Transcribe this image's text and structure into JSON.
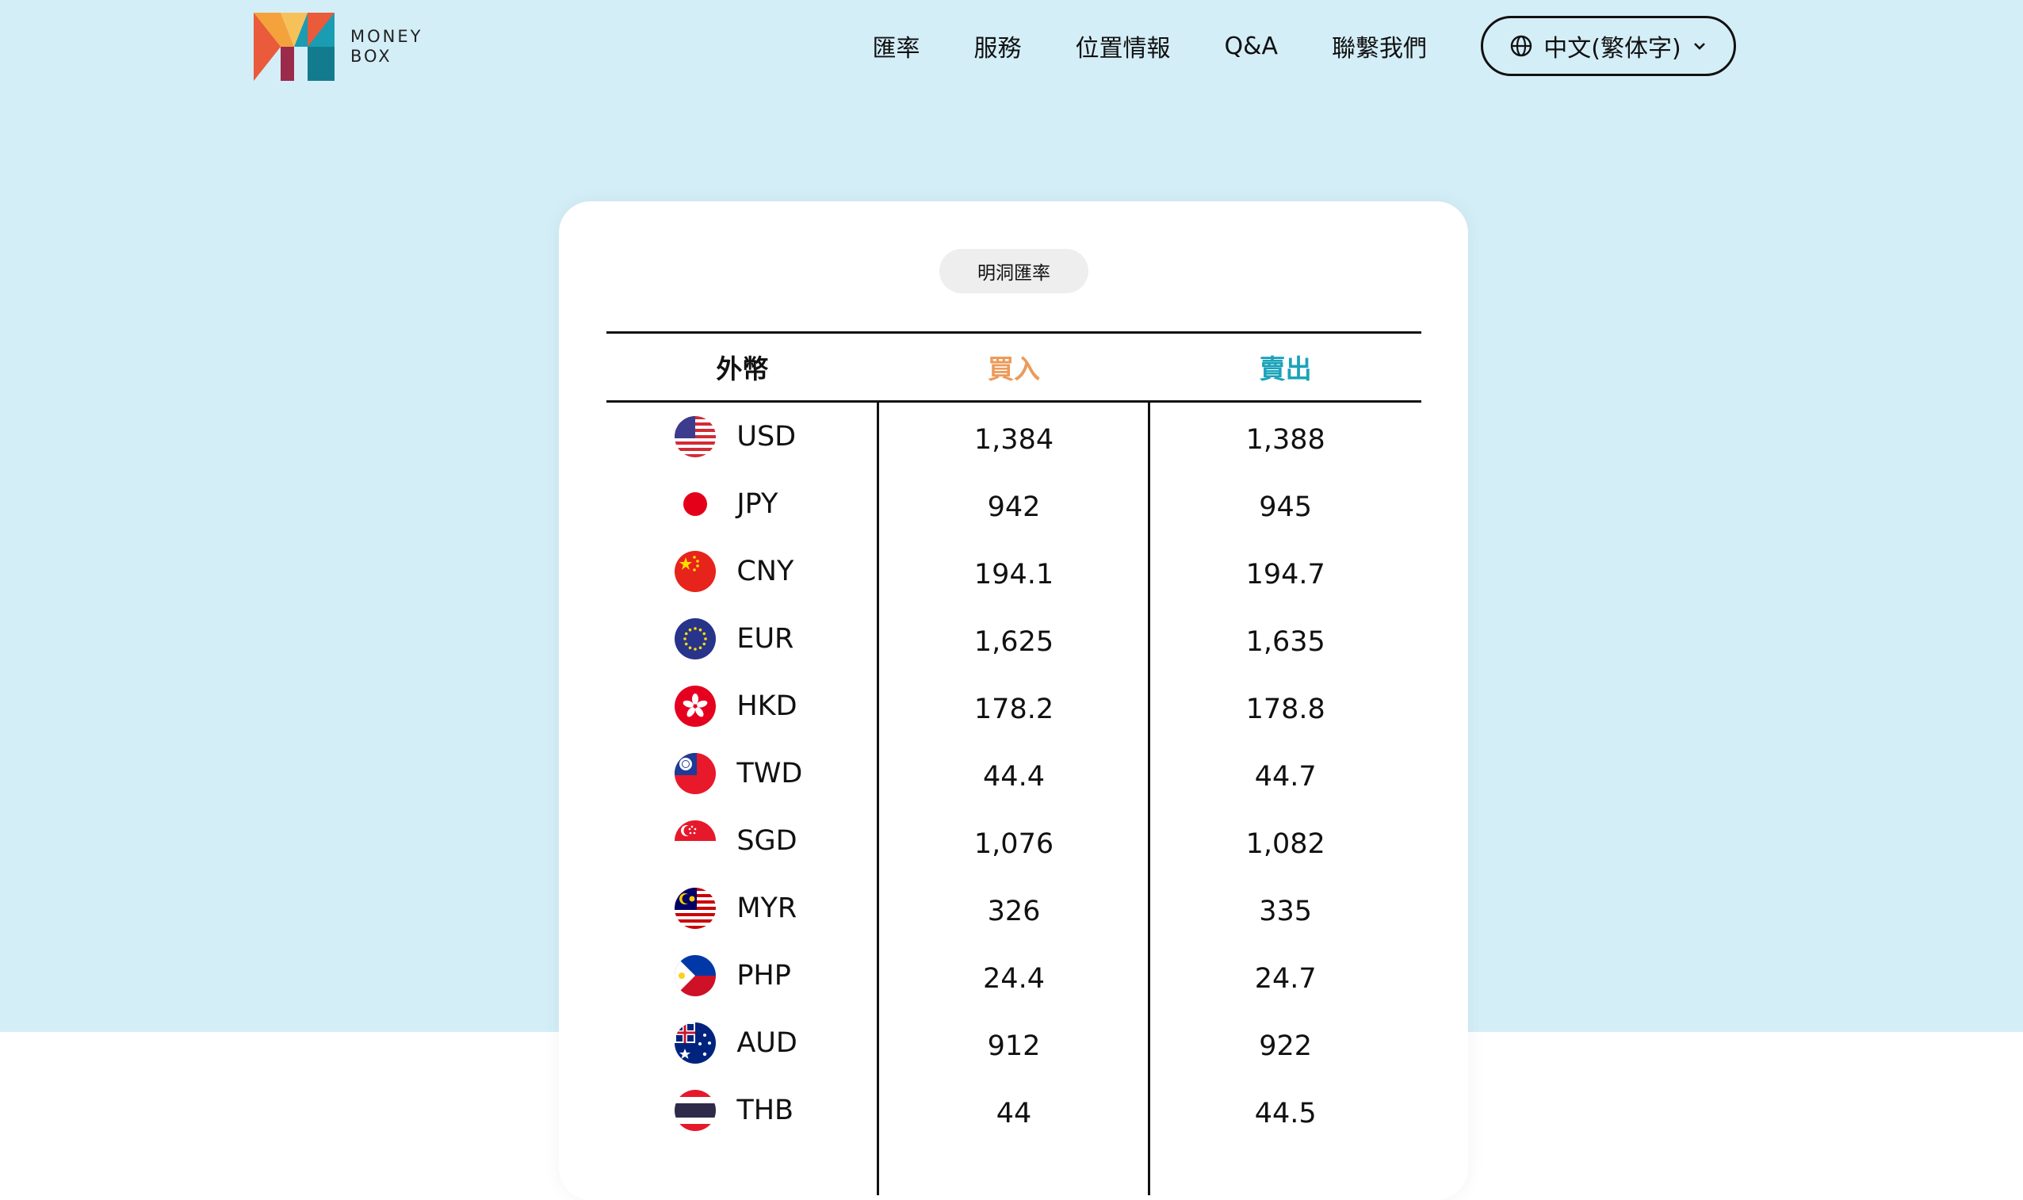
{
  "header": {
    "logo_line1": "MONEY",
    "logo_line2": "BOX",
    "nav": [
      "匯率",
      "服務",
      "位置情報",
      "Q&A",
      "聯繫我們"
    ],
    "language": "中文(繁体字)"
  },
  "colors": {
    "background": "#d4eef8",
    "buy": "#ec9a5a",
    "sell": "#1ba3b9",
    "logo": [
      "#f4a23c",
      "#e95b3b",
      "#1a9db3",
      "#9c2a4a"
    ]
  },
  "rates": {
    "title": "明洞匯率",
    "columns": [
      "外幣",
      "買入",
      "賣出"
    ],
    "rows": [
      {
        "code": "USD",
        "flag": "us-flag-icon",
        "buy": "1,384",
        "sell": "1,388"
      },
      {
        "code": "JPY",
        "flag": "jp-flag-icon",
        "buy": "942",
        "sell": "945"
      },
      {
        "code": "CNY",
        "flag": "cn-flag-icon",
        "buy": "194.1",
        "sell": "194.7"
      },
      {
        "code": "EUR",
        "flag": "eu-flag-icon",
        "buy": "1,625",
        "sell": "1,635"
      },
      {
        "code": "HKD",
        "flag": "hk-flag-icon",
        "buy": "178.2",
        "sell": "178.8"
      },
      {
        "code": "TWD",
        "flag": "tw-flag-icon",
        "buy": "44.4",
        "sell": "44.7"
      },
      {
        "code": "SGD",
        "flag": "sg-flag-icon",
        "buy": "1,076",
        "sell": "1,082"
      },
      {
        "code": "MYR",
        "flag": "my-flag-icon",
        "buy": "326",
        "sell": "335"
      },
      {
        "code": "PHP",
        "flag": "ph-flag-icon",
        "buy": "24.4",
        "sell": "24.7"
      },
      {
        "code": "AUD",
        "flag": "au-flag-icon",
        "buy": "912",
        "sell": "922"
      },
      {
        "code": "THB",
        "flag": "th-flag-icon",
        "buy": "44",
        "sell": "44.5"
      }
    ]
  }
}
